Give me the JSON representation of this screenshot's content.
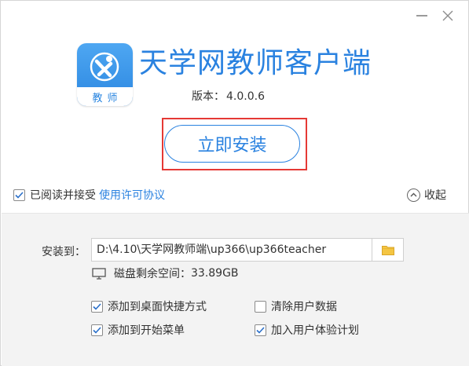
{
  "window": {
    "title": "天学网教师客户端",
    "minimize_icon": "minimize-icon",
    "close_icon": "close-icon"
  },
  "app": {
    "icon_label": "教师",
    "title": "天学网教师客户端",
    "version_label": "版本：",
    "version_value": "4.0.0.6"
  },
  "install": {
    "label": "立即安装",
    "highlight_color": "#e53935"
  },
  "agreement": {
    "checked": true,
    "text": "已阅读并接受",
    "link": "使用许可协议"
  },
  "collapse": {
    "label": "收起",
    "icon": "chevron-up-icon"
  },
  "path": {
    "label": "安装到：",
    "value": "D:\\4.10\\天学网教师端\\up366\\up366teacher",
    "browse_icon": "folder-icon"
  },
  "disk": {
    "label": "磁盘剩余空间：",
    "value": "33.89GB"
  },
  "options": [
    {
      "label": "添加到桌面快捷方式",
      "checked": true
    },
    {
      "label": "清除用户数据",
      "checked": false
    },
    {
      "label": "添加到开始菜单",
      "checked": true
    },
    {
      "label": "加入用户体验计划",
      "checked": true
    }
  ],
  "colors": {
    "accent": "#2a82e0",
    "panel_bg": "#f3f3f3"
  }
}
